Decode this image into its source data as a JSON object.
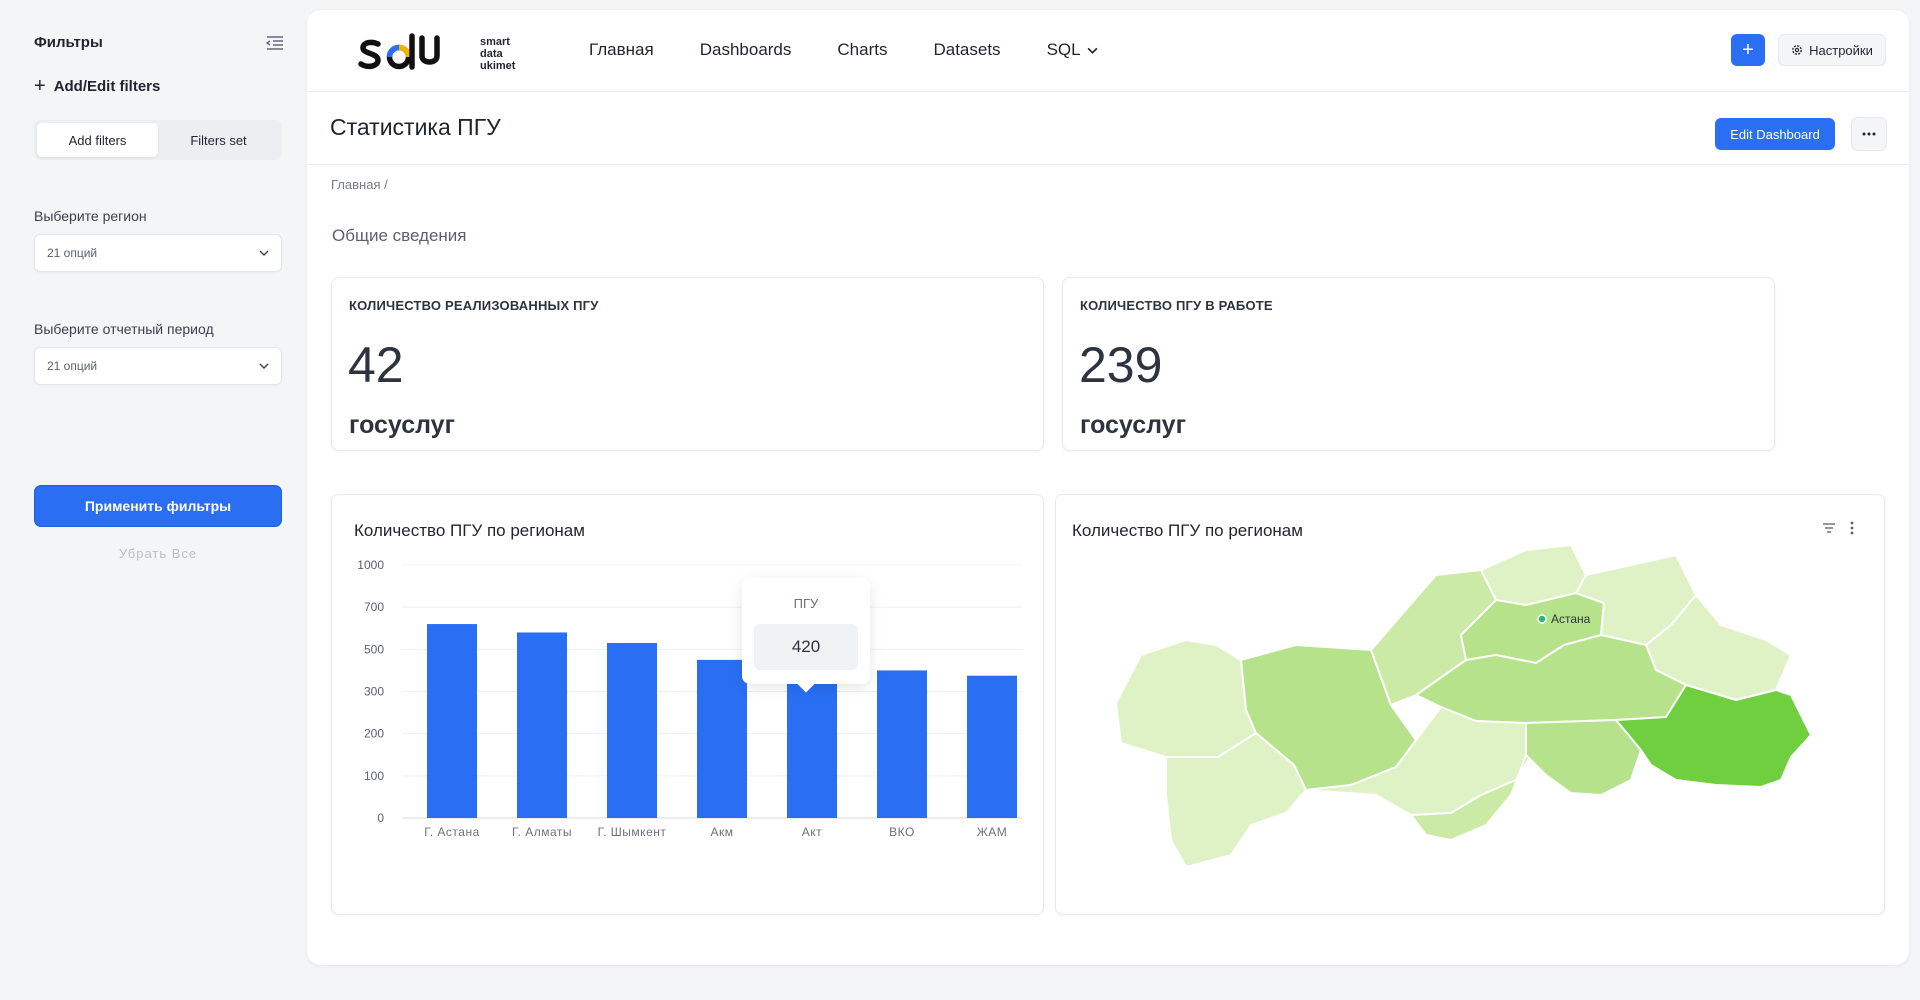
{
  "sidebar": {
    "title": "Фильтры",
    "add_edit": "Add/Edit  filters",
    "tabs": [
      "Add filters",
      "Filters set"
    ],
    "region_label": "Выберите регион",
    "region_value": "21 опций",
    "period_label": "Выберите отчетный период",
    "period_value": "21 опций",
    "apply": "Применить фильтры",
    "clear": "Убрать Все"
  },
  "logo": {
    "lines": [
      "smart",
      "data",
      "ukimet"
    ]
  },
  "nav": {
    "items": [
      "Главная",
      "Dashboards",
      "Charts",
      "Datasets",
      "SQL"
    ]
  },
  "header": {
    "plus": "+",
    "settings": "Настройки"
  },
  "page": {
    "title": "Статистика ПГУ",
    "edit": "Edit Dashboard",
    "breadcrumb": "Главная  /",
    "section": "Общие сведения"
  },
  "kpis": [
    {
      "label": "КОЛИЧЕСТВО РЕАЛИЗОВАННЫХ ПГУ",
      "value": "42",
      "unit": "госуслуг"
    },
    {
      "label": "КОЛИЧЕСТВО ПГУ В РАБОТЕ",
      "value": "239",
      "unit": "госуслуг"
    }
  ],
  "chart_data": {
    "type": "bar",
    "title": "Количество ПГУ по регионам",
    "categories": [
      "Г. Астана",
      "Г. Алматы",
      "Г. Шымкент",
      "Акм",
      "Акт",
      "ВКО",
      "ЖАМ"
    ],
    "values": [
      620,
      580,
      530,
      450,
      420,
      400,
      375
    ],
    "yticks": [
      0,
      100,
      200,
      300,
      500,
      700,
      1000
    ],
    "tooltip": {
      "title": "ПГУ",
      "category": "Акт",
      "value": "420"
    },
    "color": "#2a6ff3"
  },
  "map": {
    "title": "Количество ПГУ по регионам",
    "city_label": "Астана",
    "colors": [
      "#dff2c6",
      "#cbeaa6",
      "#b5e28a",
      "#9fd86e",
      "#6fcf3f"
    ]
  }
}
